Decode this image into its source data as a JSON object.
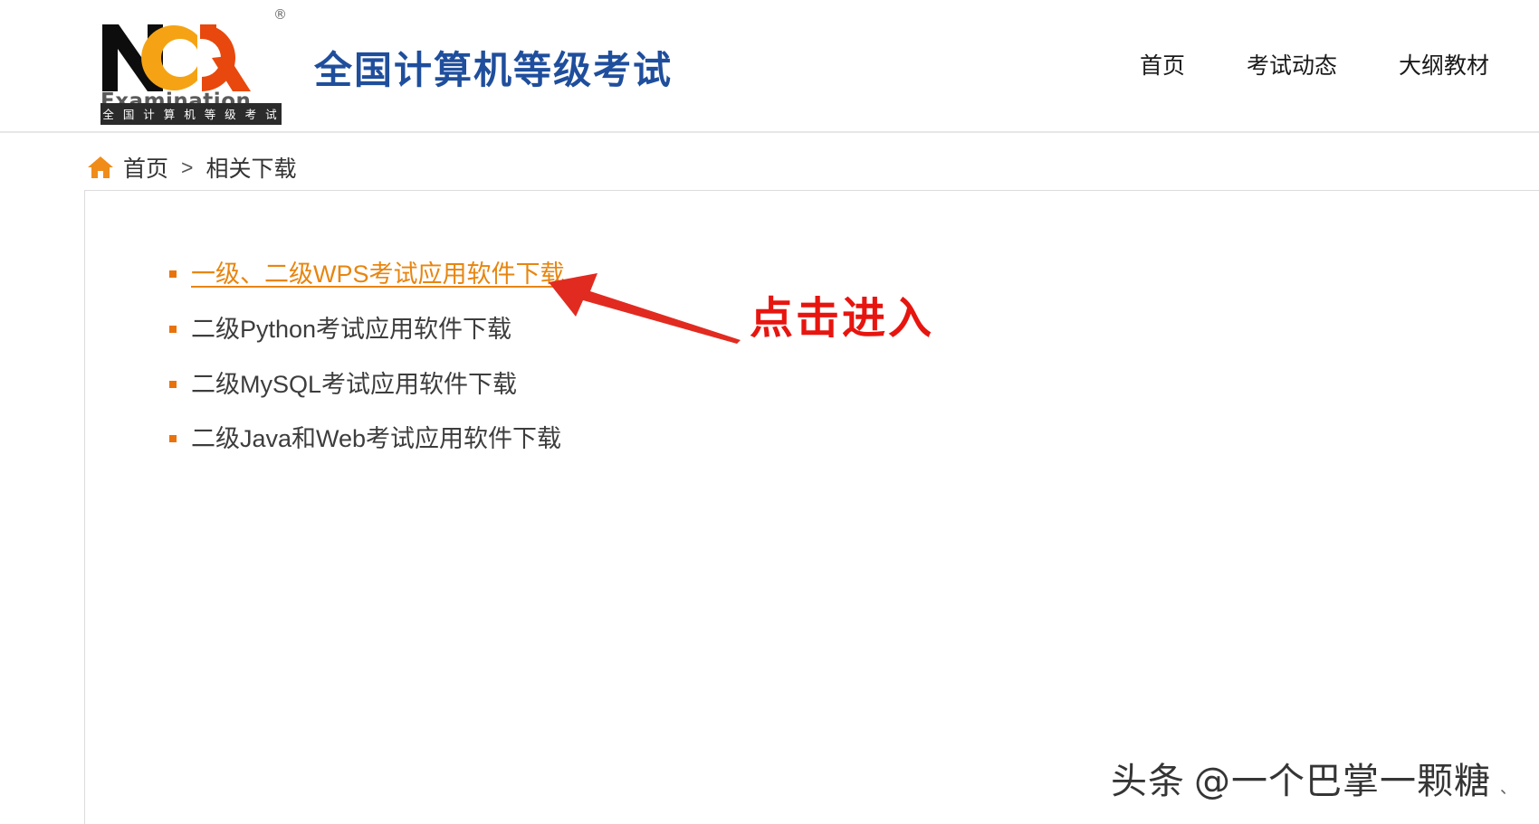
{
  "header": {
    "logo": {
      "wordmark": "NCRE",
      "subtitle": "Examination",
      "registered_mark": "®",
      "bar_text": "全 国 计 算 机 等 级 考 试"
    },
    "site_title": "全国计算机等级考试",
    "nav": [
      {
        "label": "首页"
      },
      {
        "label": "考试动态"
      },
      {
        "label": "大纲教材"
      }
    ]
  },
  "breadcrumb": {
    "home_icon": "home-icon",
    "home_label": "首页",
    "separator": ">",
    "current": "相关下载"
  },
  "main": {
    "downloads": [
      {
        "label": "一级、二级WPS考试应用软件下载",
        "active": true
      },
      {
        "label": "二级Python考试应用软件下载",
        "active": false
      },
      {
        "label": "二级MySQL考试应用软件下载",
        "active": false
      },
      {
        "label": "二级Java和Web考试应用软件下载",
        "active": false
      }
    ]
  },
  "annotation": {
    "text": "点击进入",
    "arrow_color": "#e22b20",
    "text_color": "#e7150f"
  },
  "watermark": {
    "platform": "头条",
    "handle": "@一个巴掌一颗糖",
    "tail": "、"
  },
  "colors": {
    "accent_orange": "#e8730c",
    "title_blue": "#1f4e9c",
    "annotation_red": "#e7150f",
    "border_gray": "#dcdcdc"
  }
}
